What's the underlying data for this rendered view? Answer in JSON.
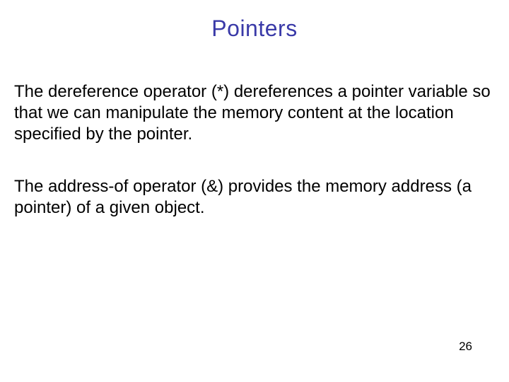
{
  "slide": {
    "title": "Pointers",
    "paragraph1": "The dereference operator (*) dereferences a pointer variable so that we can manipulate the memory content at the location specified by the pointer.",
    "paragraph2": "The address-of operator (&) provides the memory address (a pointer) of a given object.",
    "pageNumber": "26"
  }
}
